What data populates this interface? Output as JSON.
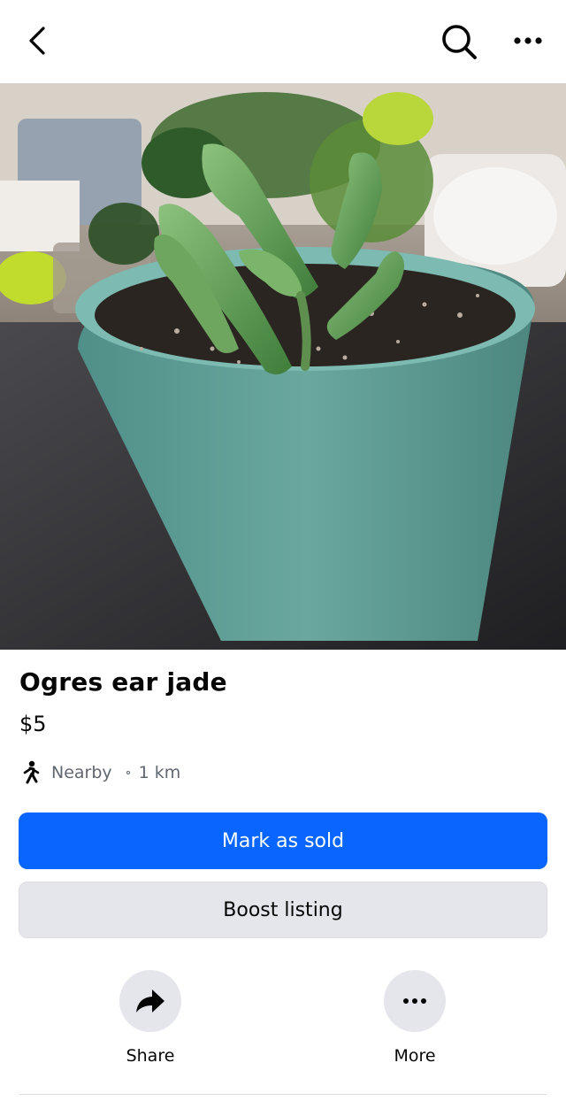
{
  "header": {
    "back_icon": "chevron-left-icon",
    "search_icon": "search-icon",
    "menu_icon": "more-horizontal-icon"
  },
  "listing": {
    "title": "Ogres ear jade",
    "price": "$5",
    "location_label": "Nearby",
    "distance": "1 km",
    "location_icon": "walking-person-icon"
  },
  "buttons": {
    "mark_sold": "Mark as sold",
    "boost": "Boost listing"
  },
  "actions": [
    {
      "label": "Share",
      "icon": "share-arrow-icon"
    },
    {
      "label": "More",
      "icon": "more-horizontal-icon"
    }
  ],
  "colors": {
    "primary": "#0866ff",
    "secondary_bg": "#e4e6eb",
    "meta_text": "#606770"
  }
}
